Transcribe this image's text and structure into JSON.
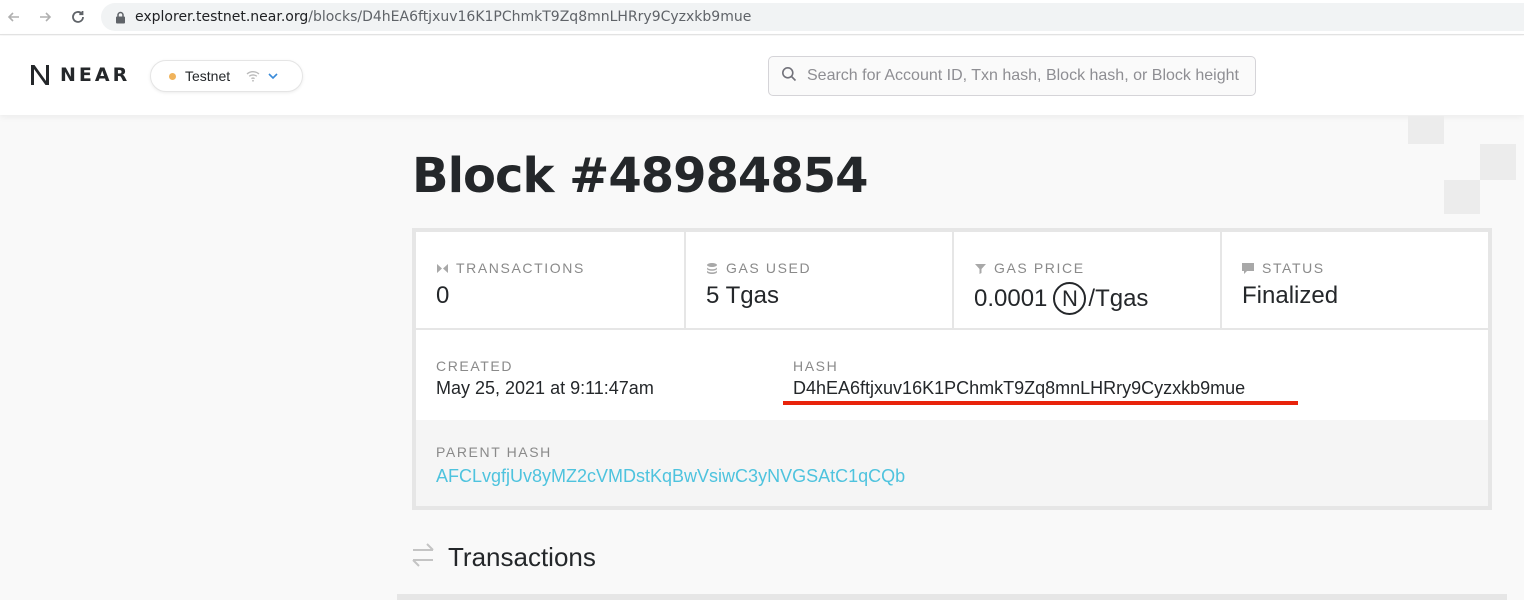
{
  "browser": {
    "url_domain": "explorer.testnet.near.org",
    "url_path": "/blocks/D4hEA6ftjxuv16K1PChmkT9Zq8mnLHRry9Cyzxkb9mue"
  },
  "header": {
    "logo_text": "NEAR",
    "network_label": "Testnet",
    "network_dot_color": "#f0b35b",
    "search_placeholder": "Search for Account ID, Txn hash, Block hash, or Block height"
  },
  "block": {
    "title": "Block #48984854",
    "stats": [
      {
        "label": "TRANSACTIONS",
        "value": "0",
        "icon": "transactions-icon"
      },
      {
        "label": "GAS USED",
        "value": "5 Tgas",
        "icon": "gas-used-icon"
      },
      {
        "label": "GAS PRICE",
        "value": "0.0001",
        "unit_symbol": "N",
        "unit_suffix": "/Tgas",
        "icon": "gas-price-icon"
      },
      {
        "label": "STATUS",
        "value": "Finalized",
        "icon": "status-icon"
      }
    ],
    "created_label": "CREATED",
    "created_value": "May 25, 2021 at 9:11:47am",
    "hash_label": "HASH",
    "hash_value": "D4hEA6ftjxuv16K1PChmkT9Zq8mnLHRry9Cyzxkb9mue",
    "hash_highlight_color": "#e8230b",
    "parent_hash_label": "PARENT HASH",
    "parent_hash_value": "AFCLvgfjUv8yMZ2cVMDstKqBwVsiwC3yNVGSAtC1qCQb",
    "link_color": "#4ec3de"
  },
  "transactions_section": {
    "title": "Transactions"
  }
}
